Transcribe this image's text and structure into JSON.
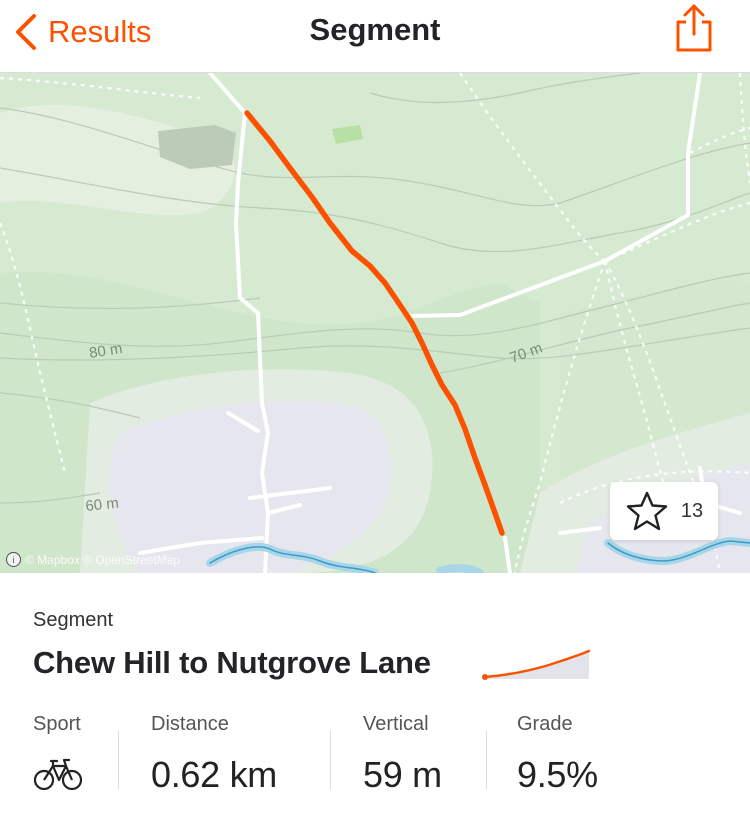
{
  "navbar": {
    "back_label": "Results",
    "title": "Segment"
  },
  "map": {
    "contour_labels": [
      "80 m",
      "70 m",
      "60 m"
    ],
    "attribution": "© Mapbox © OpenStreetMap",
    "star_count": "13",
    "route_color": "#fc5200"
  },
  "segment": {
    "label": "Segment",
    "name": "Chew Hill to Nutgrove Lane"
  },
  "stats": [
    {
      "key": "Sport",
      "icon": "bike-icon"
    },
    {
      "key": "Distance",
      "value": "0.62 km"
    },
    {
      "key": "Vertical",
      "value": "59 m"
    },
    {
      "key": "Grade",
      "value": "9.5%"
    }
  ],
  "colors": {
    "accent": "#fc5200",
    "map_green": "#d9ecd5",
    "map_urban": "#e6e6ee"
  }
}
